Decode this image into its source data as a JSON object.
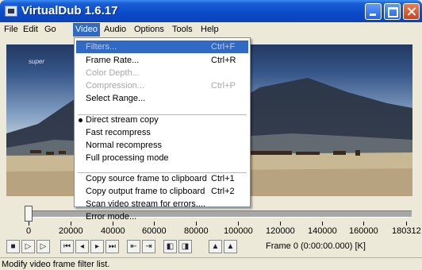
{
  "window": {
    "title": "VirtualDub 1.6.17"
  },
  "menubar": {
    "items": [
      "File",
      "Edit",
      "Go",
      "Video",
      "Audio",
      "Options",
      "Tools",
      "Help"
    ]
  },
  "video_menu": {
    "items": [
      {
        "label": "Filters...",
        "shortcut": "Ctrl+F"
      },
      {
        "label": "Frame Rate...",
        "shortcut": "Ctrl+R"
      },
      {
        "label": "Color Depth...",
        "shortcut": ""
      },
      {
        "label": "Compression...",
        "shortcut": "Ctrl+P"
      },
      {
        "label": "Select Range...",
        "shortcut": ""
      },
      {
        "label": "Direct stream copy",
        "shortcut": ""
      },
      {
        "label": "Fast recompress",
        "shortcut": ""
      },
      {
        "label": "Normal recompress",
        "shortcut": ""
      },
      {
        "label": "Full processing mode",
        "shortcut": ""
      },
      {
        "label": "Copy source frame to clipboard",
        "shortcut": "Ctrl+1"
      },
      {
        "label": "Copy output frame to clipboard",
        "shortcut": "Ctrl+2"
      },
      {
        "label": "Scan video stream for errors....",
        "shortcut": ""
      },
      {
        "label": "Error mode...",
        "shortcut": ""
      }
    ],
    "highlighted_item": "Filters...",
    "disabled_items": [
      "Filters...",
      "Color Depth...",
      "Compression..."
    ],
    "checked_item": "Direct stream copy"
  },
  "video": {
    "watermark": "super"
  },
  "timeline": {
    "tick_labels": [
      "0",
      "20000",
      "40000",
      "60000",
      "80000",
      "100000",
      "120000",
      "140000",
      "160000",
      "180312"
    ],
    "position_fraction": 0
  },
  "toolbar": {
    "tools": [
      {
        "icon": "stop-icon",
        "glyph": "■"
      },
      {
        "icon": "play-input-icon",
        "glyph": "▷"
      },
      {
        "icon": "play-output-icon",
        "glyph": "▷"
      },
      {
        "icon": "go-start-icon",
        "glyph": "⏮"
      },
      {
        "icon": "prev-frame-icon",
        "glyph": "◂"
      },
      {
        "icon": "next-frame-icon",
        "glyph": "▸"
      },
      {
        "icon": "go-end-icon",
        "glyph": "⏭"
      },
      {
        "icon": "prev-keyframe-icon",
        "glyph": "⇤"
      },
      {
        "icon": "next-keyframe-icon",
        "glyph": "⇥"
      },
      {
        "icon": "scene-prev-icon",
        "glyph": "◧"
      },
      {
        "icon": "scene-next-icon",
        "glyph": "◨"
      },
      {
        "icon": "mark-in-icon",
        "glyph": "▲"
      },
      {
        "icon": "mark-out-icon",
        "glyph": "▲"
      }
    ],
    "frame_status": "Frame 0 (0:00:00.000) [K]"
  },
  "statusbar": {
    "text": "Modify video frame filter list."
  },
  "colors": {
    "title_bar": "#0a49c9",
    "menu_highlight": "#316ac5",
    "window_bg": "#ece9d8"
  }
}
